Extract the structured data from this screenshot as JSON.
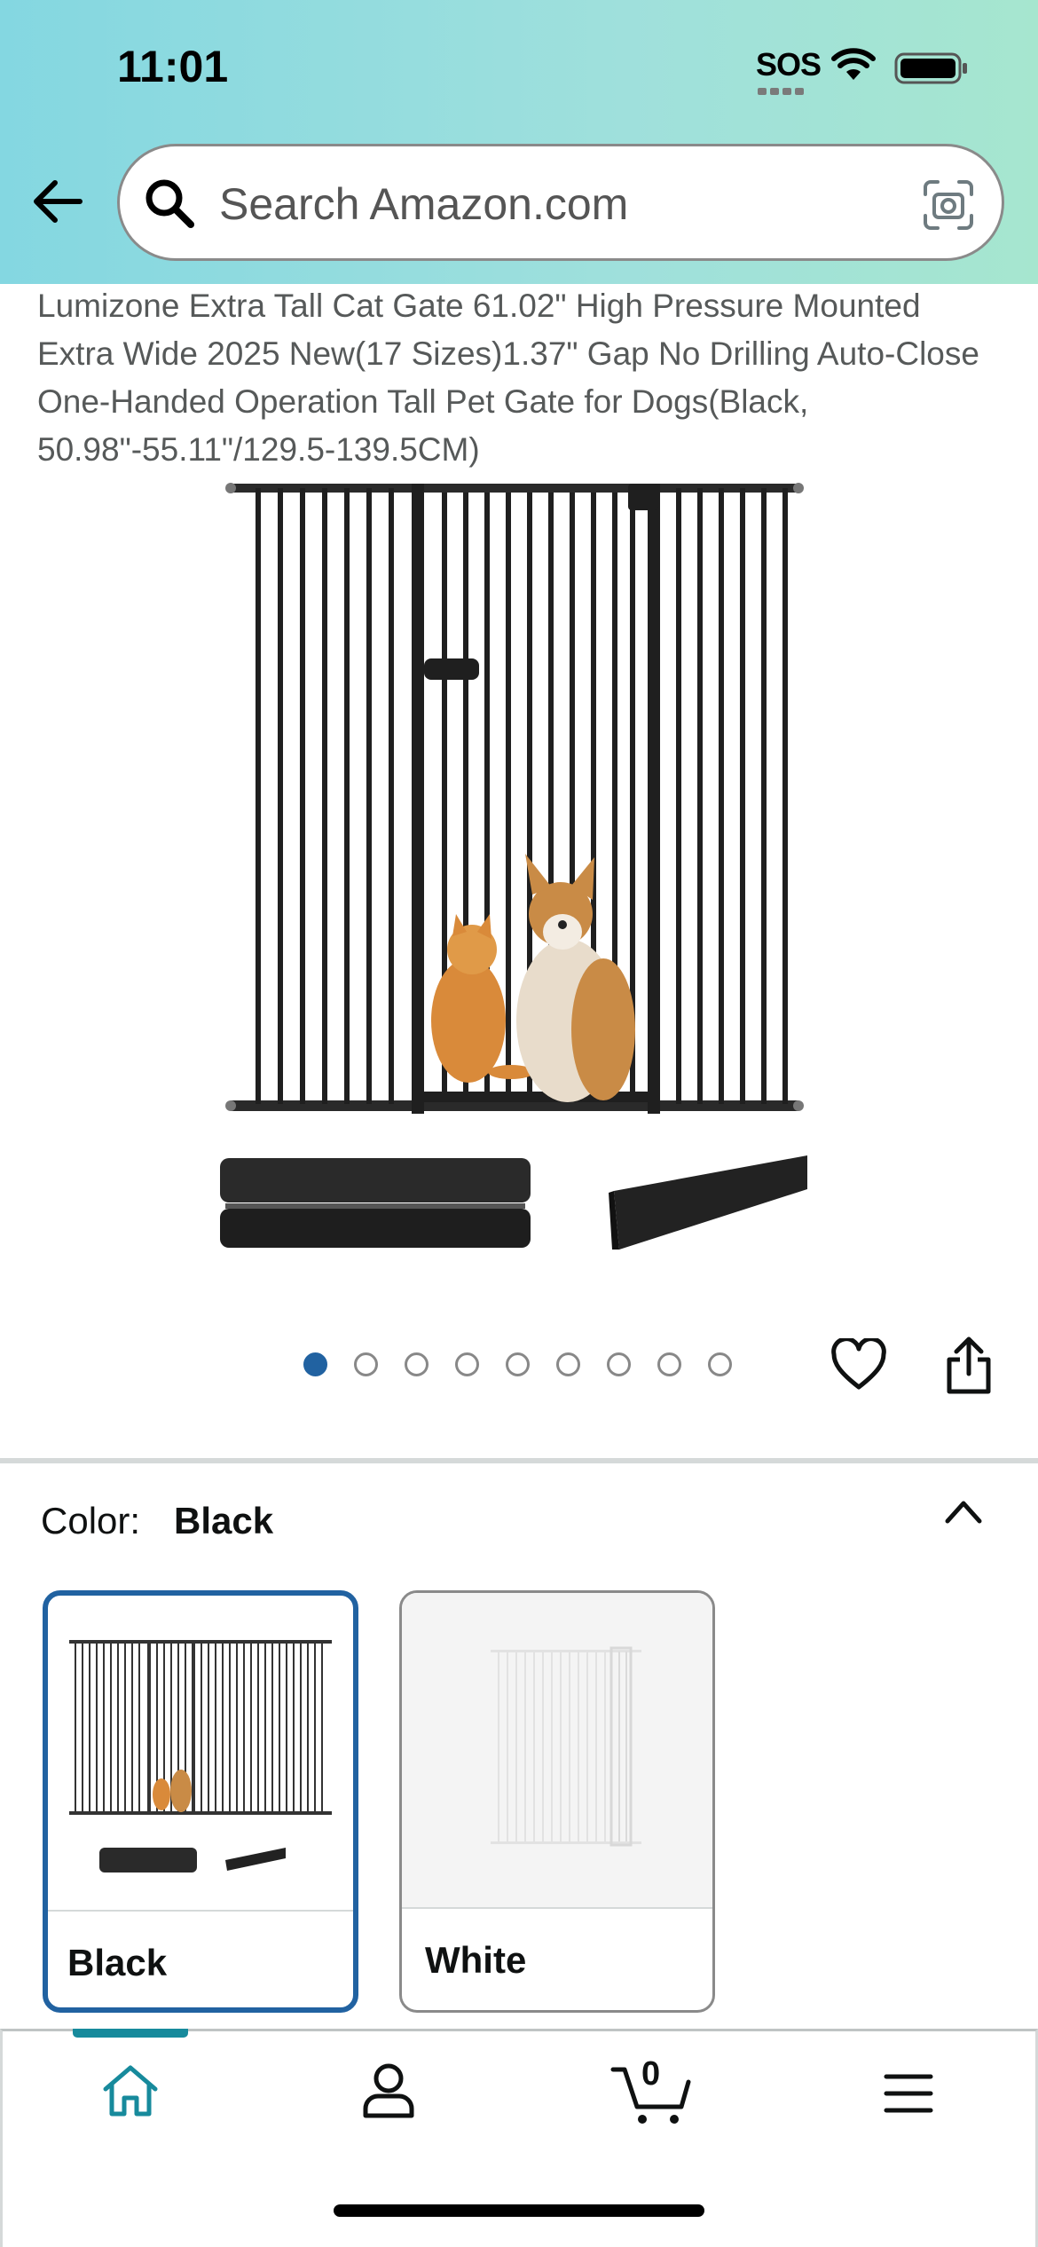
{
  "status_bar": {
    "time": "11:01",
    "sos": "SOS"
  },
  "search": {
    "placeholder": "Search Amazon.com"
  },
  "product": {
    "title": "Lumizone Extra Tall Cat Gate 61.02\" High Pressure Mounted Extra Wide 2025 New(17 Sizes)1.37\" Gap No Drilling Auto-Close One-Handed Operation Tall Pet Gate for Dogs(Black, 50.98\"-55.11\"/129.5-139.5CM)"
  },
  "carousel": {
    "total": 9,
    "active_index": 0
  },
  "color": {
    "label": "Color:",
    "selected": "Black",
    "options": [
      {
        "label": "Black"
      },
      {
        "label": "White"
      }
    ]
  },
  "bottom_nav": {
    "cart_count": "0"
  },
  "colors": {
    "accent_blue": "#2162a1",
    "nav_teal": "#178a9c",
    "header_start": "#84d7e1",
    "header_end": "#a6e6cf"
  },
  "icons": [
    "back-arrow-icon",
    "search-icon",
    "camera-icon",
    "heart-icon",
    "share-icon",
    "chevron-up-icon",
    "home-icon",
    "account-icon",
    "cart-icon",
    "menu-icon"
  ]
}
